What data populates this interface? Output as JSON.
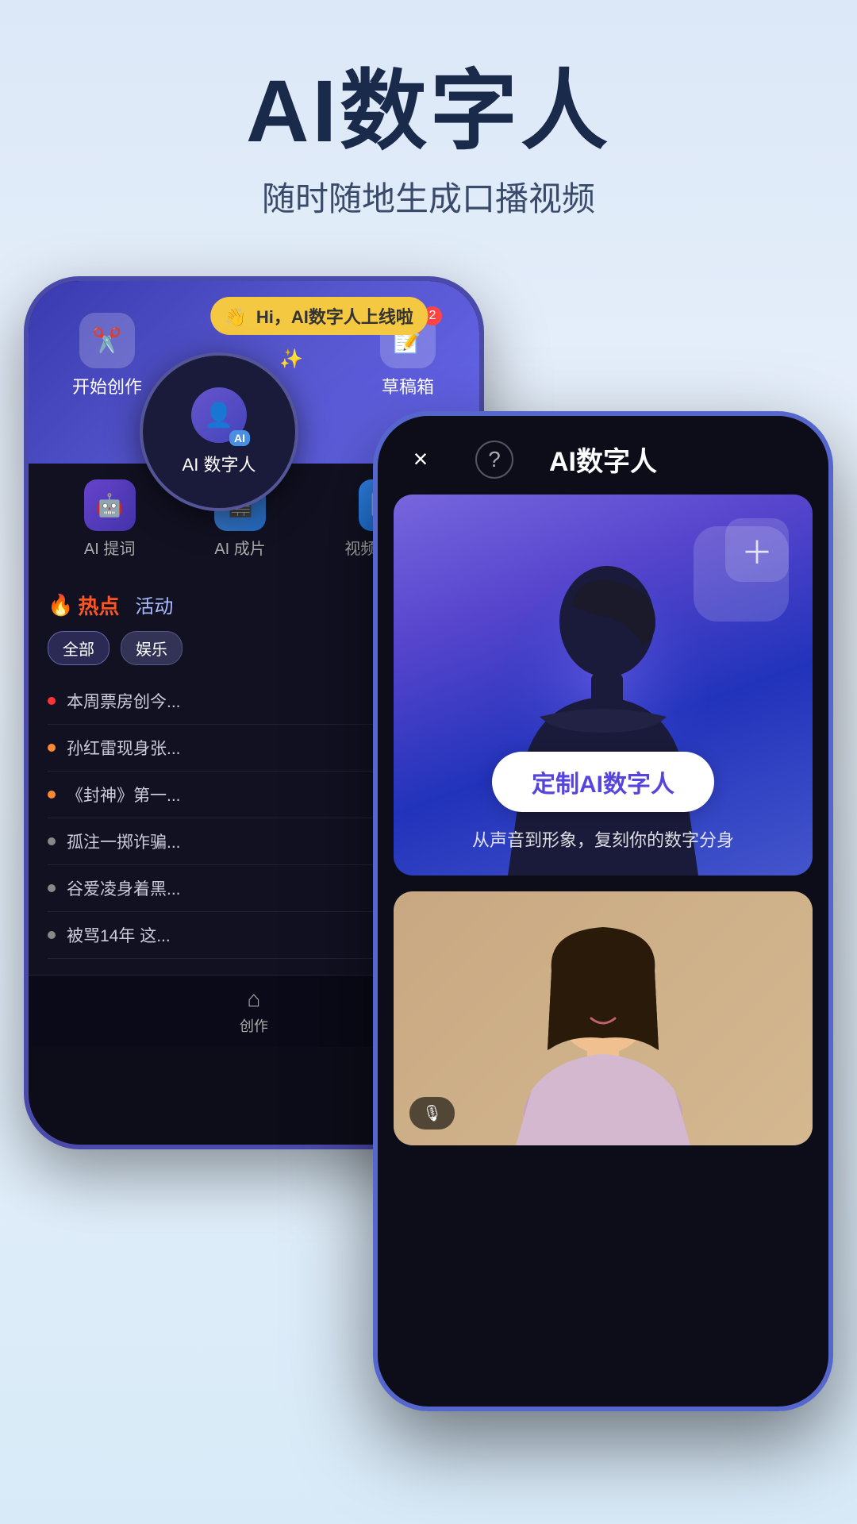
{
  "header": {
    "title": "AI数字人",
    "subtitle": "随时随地生成口播视频"
  },
  "back_phone": {
    "notification": "Hi，AI数字人上线啦",
    "ai_circle_label": "AI 数字人",
    "topbar": {
      "start_label": "开始创作",
      "draft_label": "草稿箱",
      "draft_count": "2"
    },
    "features": [
      {
        "label": "AI 提词",
        "icon": "🤖"
      },
      {
        "label": "AI 成片",
        "icon": "🎬"
      },
      {
        "label": "视频转文字",
        "icon": "🔄"
      }
    ],
    "tabs": {
      "hot": "热点",
      "activity": "活动"
    },
    "filters": [
      "全部",
      "娱乐"
    ],
    "trends": [
      {
        "text": "本周票房创今...",
        "dot": "red"
      },
      {
        "text": "孙红雷现身张...",
        "dot": "orange"
      },
      {
        "text": "《封神》第一...",
        "dot": "orange"
      },
      {
        "text": "孤注一掷诈骗...",
        "dot": "gray"
      },
      {
        "text": "谷爱凌身着黑...",
        "dot": "gray"
      },
      {
        "text": "被骂14年 这...",
        "dot": "gray"
      }
    ],
    "nav": {
      "label": "创作",
      "icon": "🏠"
    }
  },
  "front_phone": {
    "title": "AI数字人",
    "close_icon": "×",
    "help_icon": "?",
    "avatar_card": {
      "customize_btn": "定制AI数字人",
      "customize_subtitle": "从声音到形象，复刻你的数字分身"
    }
  },
  "icons": {
    "scissors": "✂",
    "fire": "🔥",
    "sparkle": "✨",
    "home": "⌂",
    "mic": "🎙"
  }
}
